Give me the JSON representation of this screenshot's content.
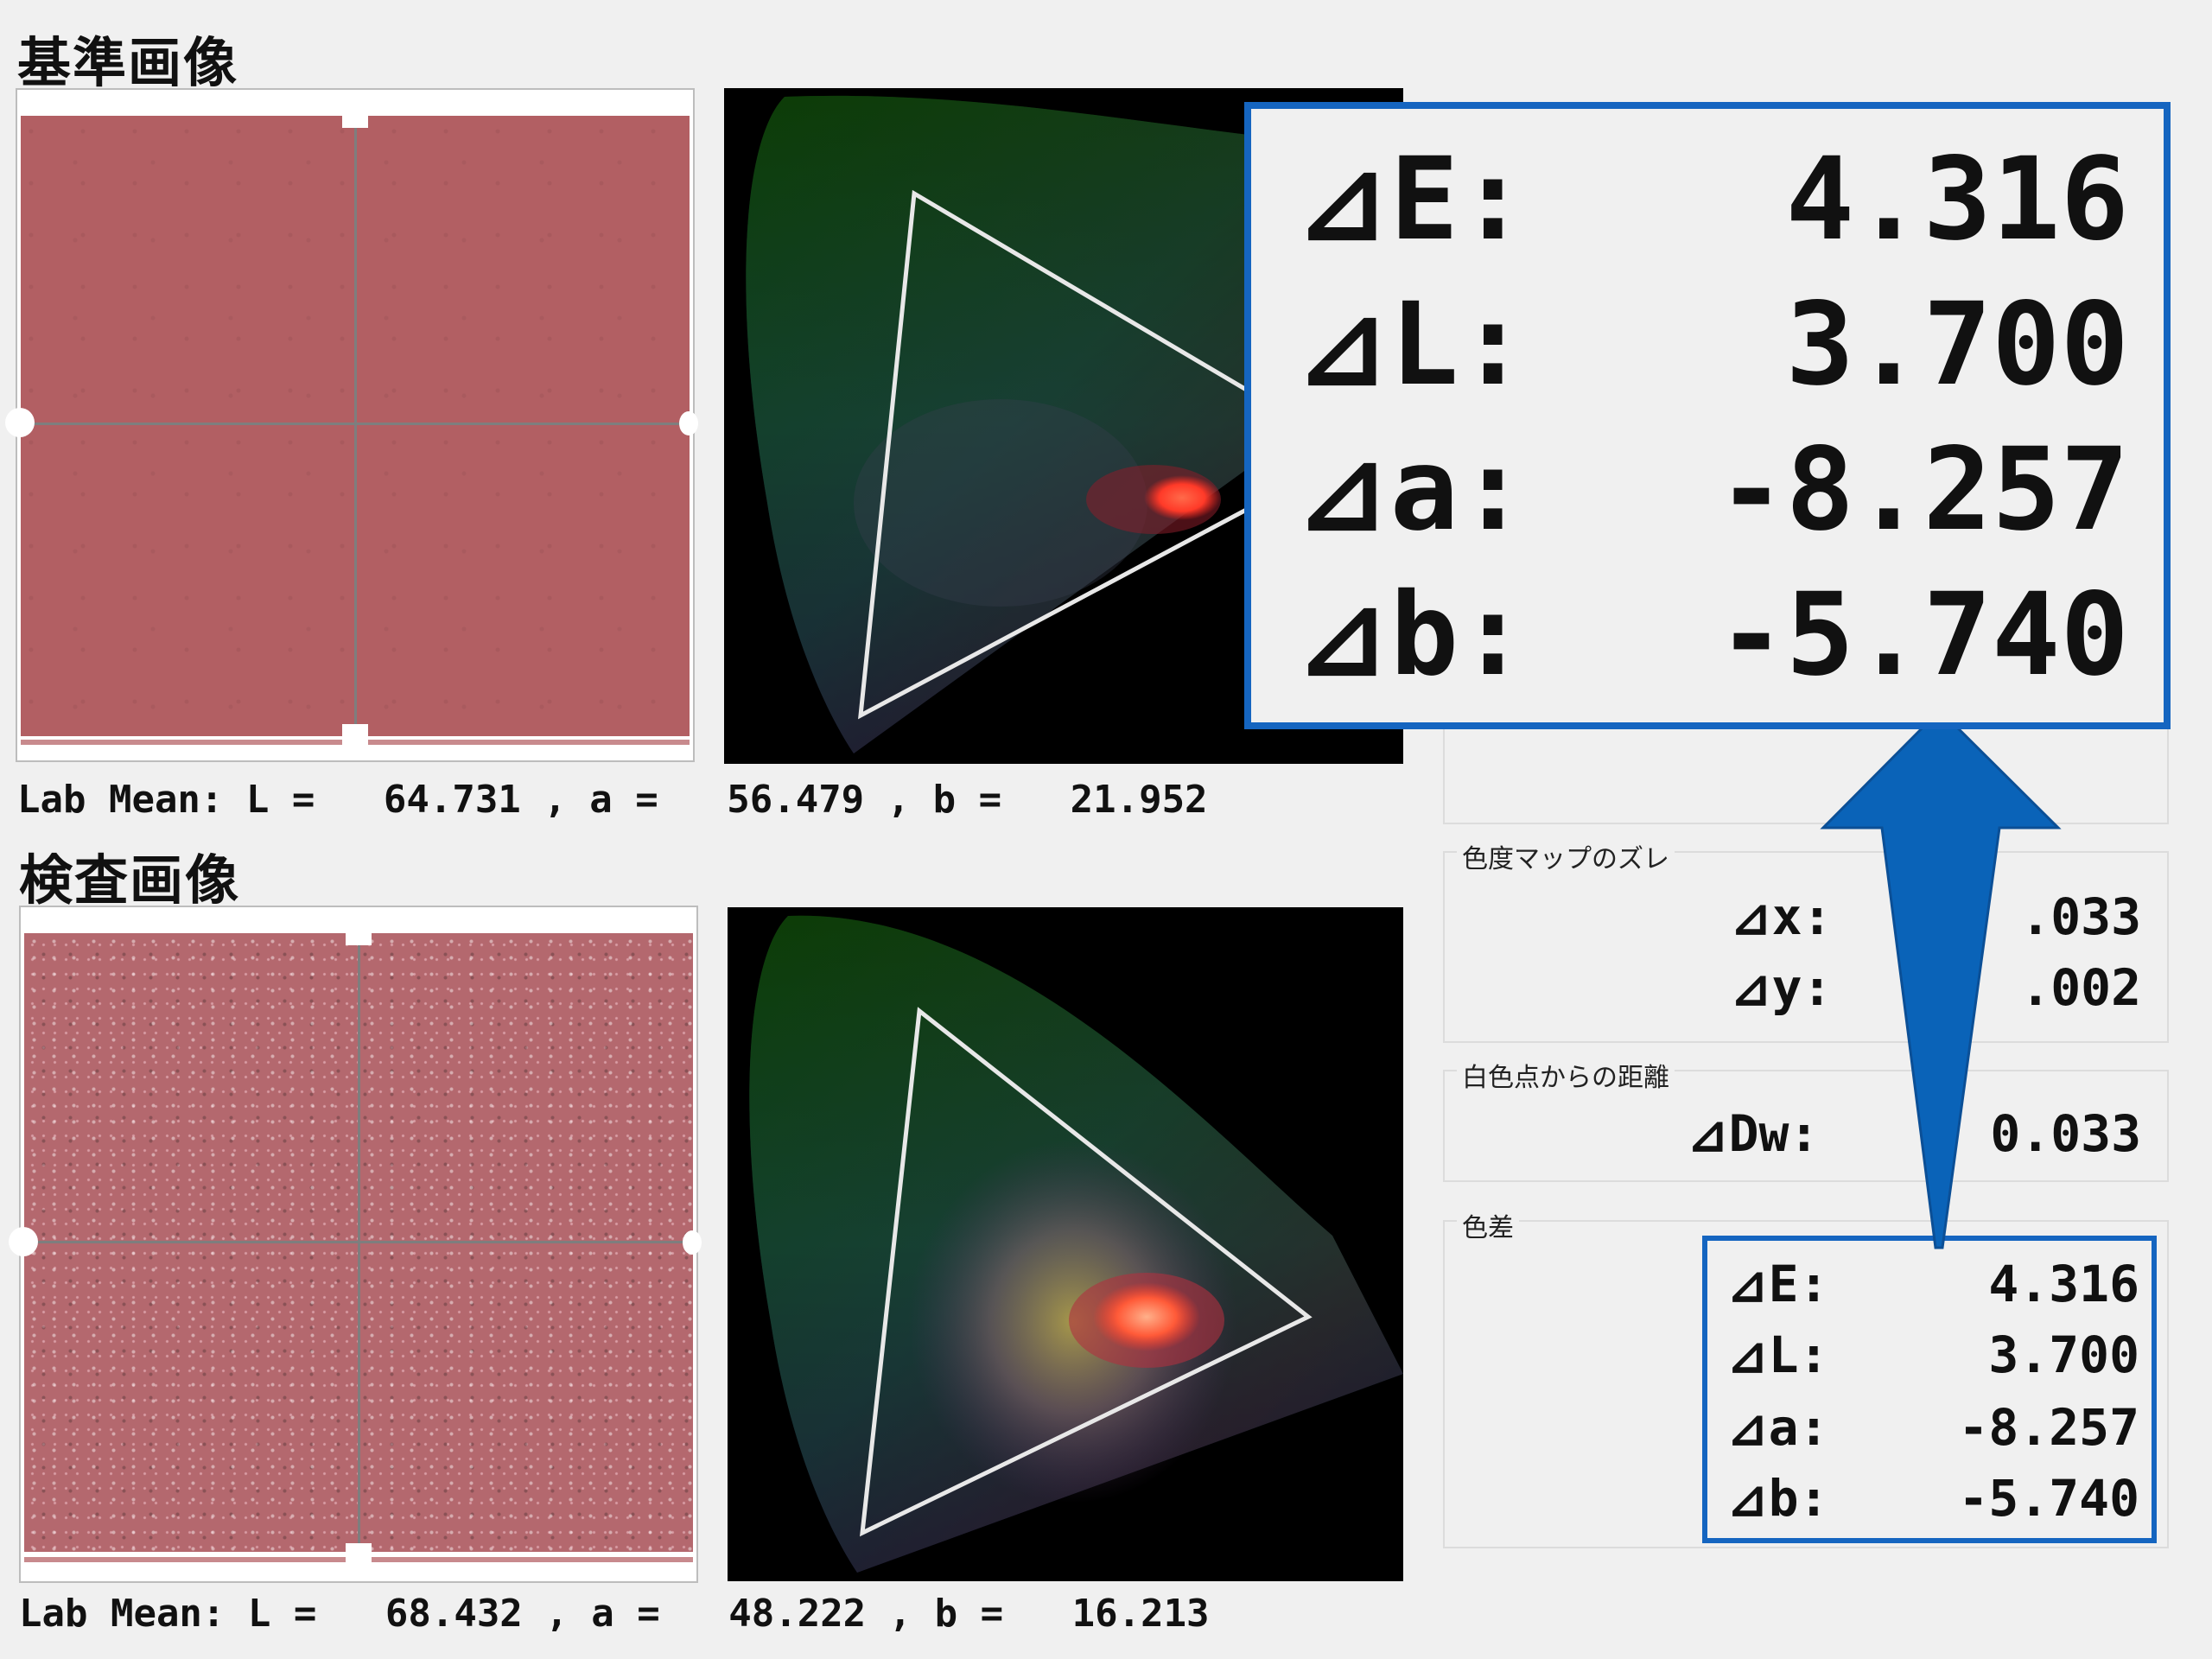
{
  "reference": {
    "title": "基準画像",
    "lab_mean": {
      "label": "Lab Mean:",
      "L": "64.731",
      "a": "56.479",
      "b": "21.952"
    },
    "sample_color": "#b25f63"
  },
  "inspection": {
    "title": "検査画像",
    "lab_mean": {
      "label": "Lab Mean:",
      "L": "68.432",
      "a": "48.222",
      "b": "16.213"
    },
    "sample_color": "#b4686e"
  },
  "chroma_map_shift": {
    "title": "色度マップのズレ",
    "dx": {
      "label": "⊿x:",
      "value": ".033"
    },
    "dy": {
      "label": "⊿y:",
      "value": ".002"
    }
  },
  "white_point_distance": {
    "title": "白色点からの距離",
    "dw": {
      "label": "⊿Dw:",
      "value": "0.033"
    }
  },
  "color_difference": {
    "title": "色差",
    "dE": {
      "label": "⊿E:",
      "value": "4.316"
    },
    "dL": {
      "label": "⊿L:",
      "value": "3.700"
    },
    "da": {
      "label": "⊿a:",
      "value": "-8.257"
    },
    "db": {
      "label": "⊿b:",
      "value": "-5.740"
    }
  },
  "zoom_callout": {
    "dE": {
      "label": "⊿E:",
      "value": "4.316"
    },
    "dL": {
      "label": "⊿L:",
      "value": "3.700"
    },
    "da": {
      "label": "⊿a:",
      "value": "-8.257"
    },
    "db": {
      "label": "⊿b:",
      "value": "-5.740"
    }
  },
  "colors": {
    "accent_blue": "#1565c0",
    "arrow_blue": "#0a63b8"
  }
}
